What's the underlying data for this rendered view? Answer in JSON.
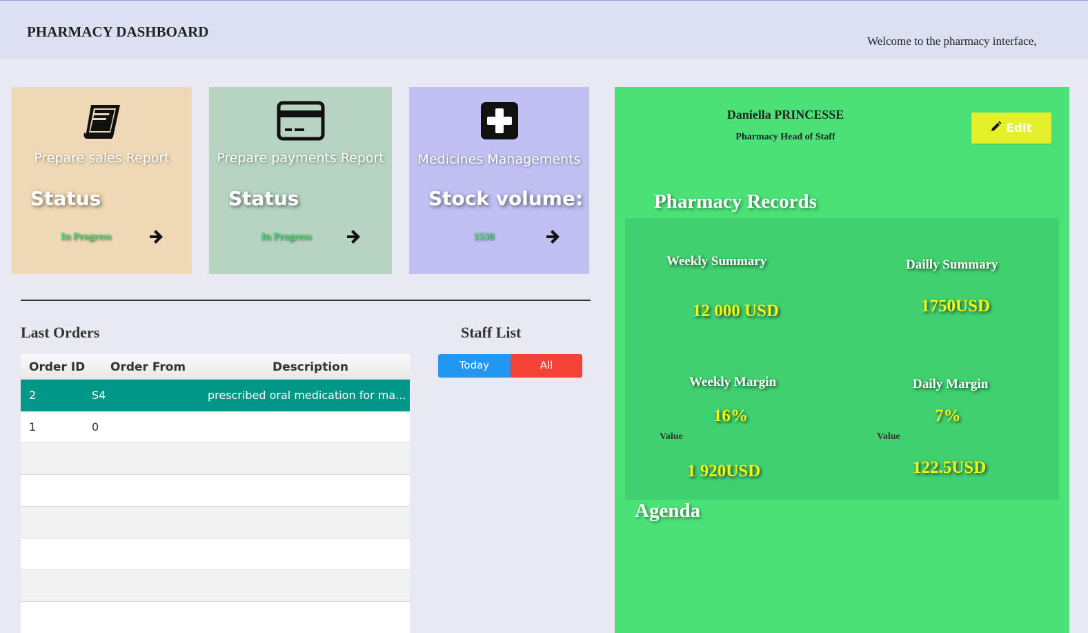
{
  "header": {
    "title": "PHARMACY DASHBOARD",
    "welcome": "Welcome to the pharmacy interface,"
  },
  "cards": [
    {
      "label": "Prepare sales Report",
      "status_label": "Status",
      "value": "In Progress",
      "icon": "book-icon",
      "color": "#efd8b5"
    },
    {
      "label": "Prepare payments Report",
      "status_label": "Status",
      "value": "In Progress",
      "icon": "credit-card-icon",
      "color": "#b6d4c1"
    },
    {
      "label": "Medicines Managements",
      "status_label": "Stock volume:",
      "value": "1530",
      "icon": "plus-square-icon",
      "color": "#c0c0f3"
    }
  ],
  "orders": {
    "title": "Last Orders",
    "columns": [
      "Order ID",
      "Order From",
      "Description"
    ],
    "rows": [
      {
        "id": "2",
        "from": "S4",
        "description": "prescribed oral medication for ma..."
      },
      {
        "id": "1",
        "from": "0",
        "description": ""
      }
    ]
  },
  "staff": {
    "title": "Staff List",
    "today_label": "Today",
    "all_label": "All"
  },
  "profile": {
    "name": "Daniella PRINCESSE",
    "role": "Pharmacy Head of Staff",
    "edit_label": "Edit"
  },
  "records": {
    "title": "Pharmacy Records",
    "weekly_summary_label": "Weekly Summary",
    "weekly_summary_value": "12 000 USD",
    "daily_summary_label": "Dailly Summary",
    "daily_summary_value": "1750USD",
    "weekly_margin_label": "Weekly Margin",
    "weekly_margin_pct": "16%",
    "weekly_value_label": "Value",
    "weekly_margin_value": "1 920USD",
    "daily_margin_label": "Daily Margin",
    "daily_margin_pct": "7%",
    "daily_value_label": "Value",
    "daily_margin_value": "122.5USD"
  },
  "agenda": {
    "title": "Agenda"
  }
}
